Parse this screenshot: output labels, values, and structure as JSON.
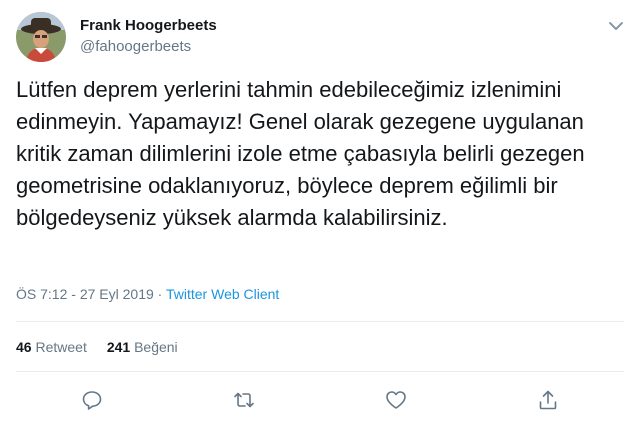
{
  "user": {
    "display_name": "Frank Hoogerbeets",
    "handle": "@fahoogerbeets",
    "avatar_icon": "avatar-photo"
  },
  "tweet": {
    "text": "Lütfen deprem yerlerini tahmin edebileceğimiz izlenimini edinmeyin. Yapamayız! Genel olarak gezegene uygulanan kritik zaman dilimlerini izole etme çabasıyla belirli gezegen geometrisine odaklanıyoruz, böylece deprem eğilimli bir bölgedeyseniz yüksek alarmda kalabilirsiniz.",
    "time": "ÖS 7:12",
    "separator": " - ",
    "date": "27 Eyl 2019",
    "dot": " · ",
    "source": "Twitter Web Client"
  },
  "stats": {
    "retweets_count": "46",
    "retweets_label": "Retweet",
    "likes_count": "241",
    "likes_label": "Beğeni"
  },
  "actions": {
    "reply_icon": "reply-icon",
    "retweet_icon": "retweet-icon",
    "like_icon": "heart-icon",
    "share_icon": "share-icon"
  },
  "colors": {
    "text": "#14171a",
    "secondary": "#657786",
    "link": "#1b95e0",
    "divider": "#e6ecf0"
  }
}
